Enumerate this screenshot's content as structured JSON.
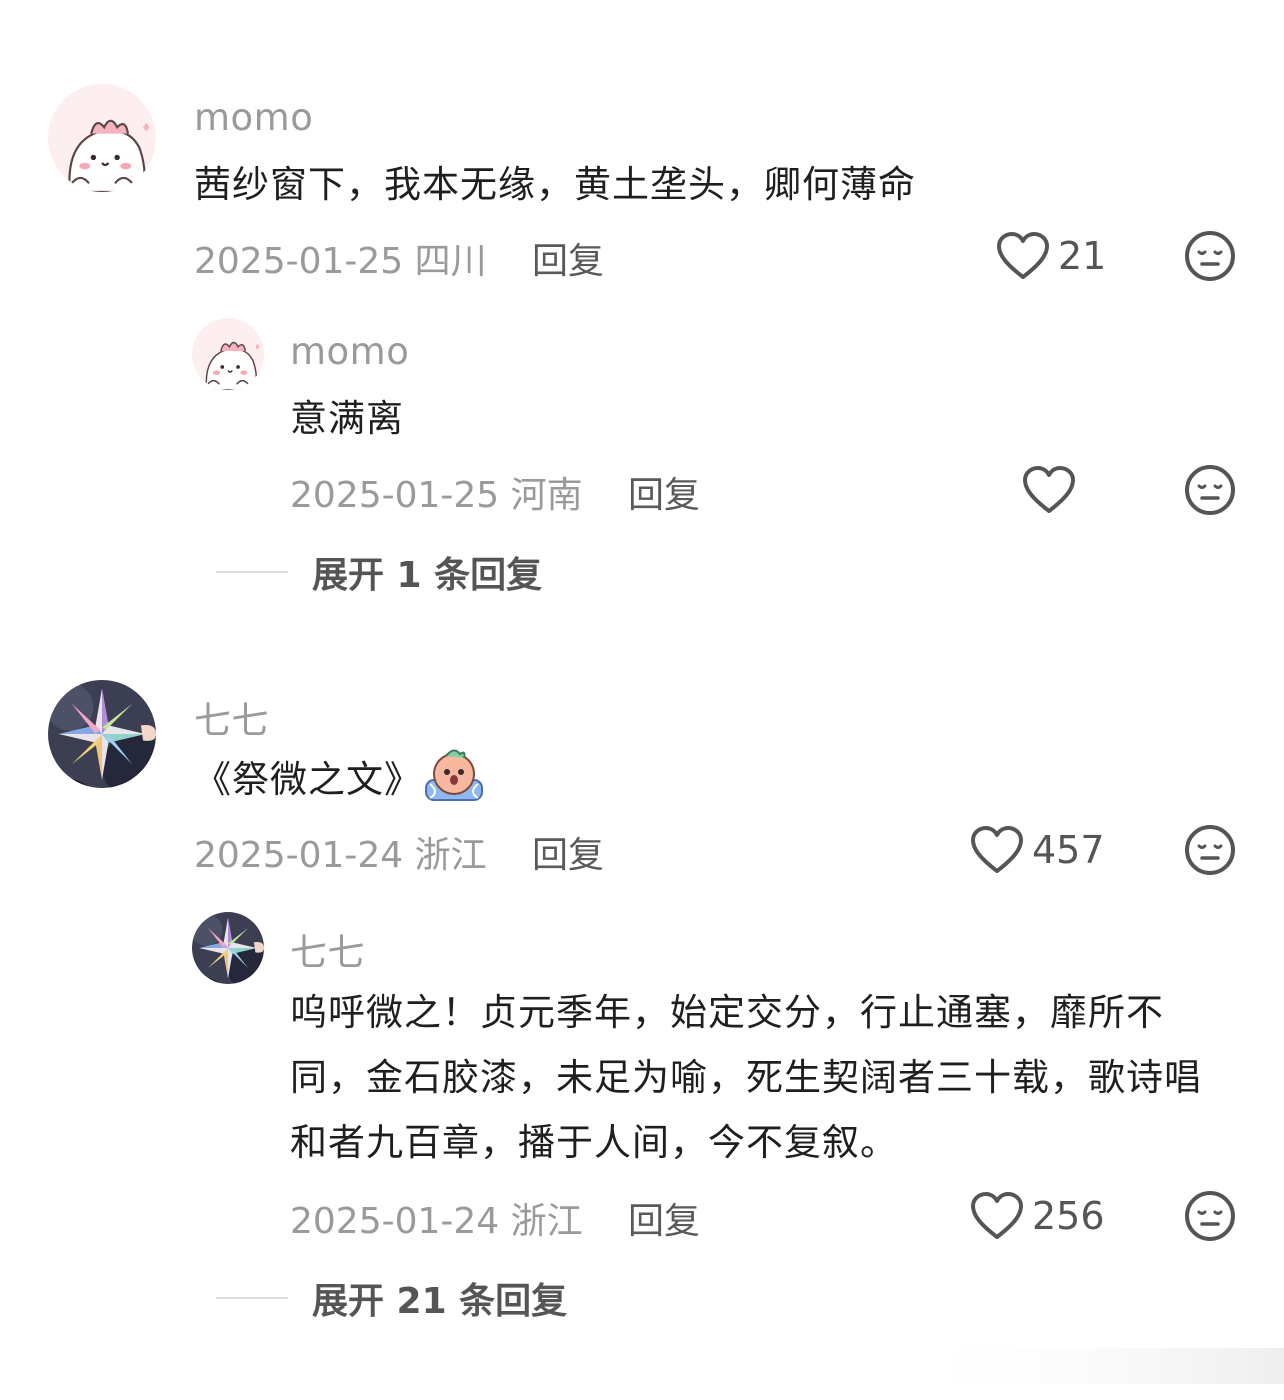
{
  "comments": [
    {
      "author": "momo",
      "text": "茜纱窗下，我本无缘，黄土垄头，卿何薄命",
      "date": "2025-01-25",
      "location": "四川",
      "reply_label": "回复",
      "likes": "21",
      "avatar_icon": "pink-dino-avatar",
      "replies": [
        {
          "author": "momo",
          "text": "意满离",
          "date": "2025-01-25",
          "location": "河南",
          "reply_label": "回复",
          "likes": "",
          "avatar_icon": "pink-dino-avatar"
        }
      ],
      "expand_label": "展开 1 条回复"
    },
    {
      "author": "七七",
      "text": "《祭微之文》",
      "emoji": "crying-emoji",
      "date": "2025-01-24",
      "location": "浙江",
      "reply_label": "回复",
      "likes": "457",
      "avatar_icon": "star-avatar",
      "replies": [
        {
          "author": "七七",
          "text": "呜呼微之！贞元季年，始定交分，行止通塞，靡所不同，金石胶漆，未足为喻，死生契阔者三十载，歌诗唱和者九百章，播于人间，今不复叙。",
          "date": "2025-01-24",
          "location": "浙江",
          "reply_label": "回复",
          "likes": "256",
          "avatar_icon": "star-avatar"
        }
      ],
      "expand_label": "展开 21 条回复"
    }
  ]
}
